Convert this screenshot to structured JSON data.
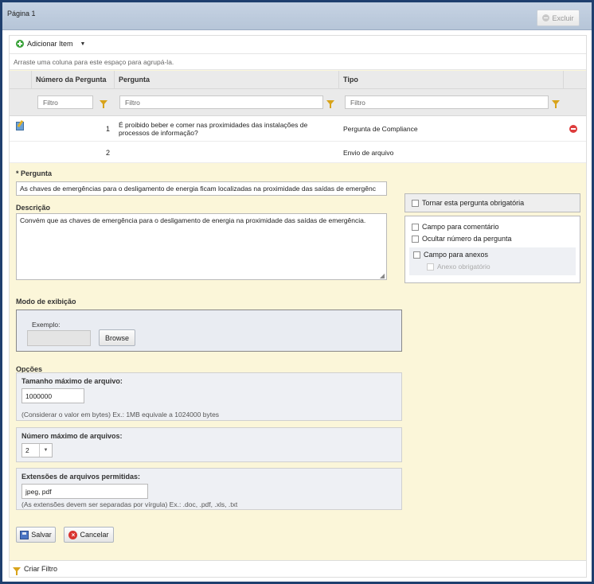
{
  "window": {
    "title": "Página 1",
    "delete_label": "Excluir"
  },
  "toolbar": {
    "add_item_label": "Adicionar Item"
  },
  "grid": {
    "group_hint": "Arraste uma coluna para este espaço para agrupá-la.",
    "columns": {
      "number": "Número da Pergunta",
      "question": "Pergunta",
      "type": "Tipo"
    },
    "filter_placeholder": "Filtro",
    "rows": [
      {
        "number": "1",
        "question": "É proibido beber e comer nas proximidades das instalações de processos de informação?",
        "type": "Pergunta de Compliance"
      },
      {
        "number": "2",
        "question": "",
        "type": "Envio de arquivo"
      }
    ]
  },
  "form": {
    "question_label": "* Pergunta",
    "question_value": "As chaves de emergências para o desligamento de energia ficam localizadas na proximidade das saídas de emergênc",
    "description_label": "Descrição",
    "description_value": "Convém que as chaves de emergência para o desligamento de energia na proximidade das saídas de emergência.",
    "mandatory_label": "Tornar esta pergunta obrigatória",
    "comment_field_label": "Campo para comentário",
    "hide_number_label": "Ocultar número da pergunta",
    "attachments_field_label": "Campo para anexos",
    "attachment_required_label": "Anexo obrigatório",
    "display_mode_label": "Modo de exibição",
    "example_label": "Exemplo:",
    "browse_label": "Browse",
    "options_label": "Opções",
    "max_size_label": "Tamanho máximo de arquivo:",
    "max_size_value": "1000000",
    "max_size_hint": "(Considerar o valor em bytes) Ex.: 1MB equivale a 1024000 bytes",
    "max_files_label": "Número máximo de arquivos:",
    "max_files_value": "2",
    "extensions_label": "Extensões de arquivos permitidas:",
    "extensions_value": "jpeg, pdf",
    "extensions_hint": "(As extensões devem ser separadas por vírgula) Ex.: .doc, .pdf, .xls, .txt",
    "save_label": "Salvar",
    "cancel_label": "Cancelar"
  },
  "footer": {
    "create_filter_label": "Criar Filtro"
  }
}
